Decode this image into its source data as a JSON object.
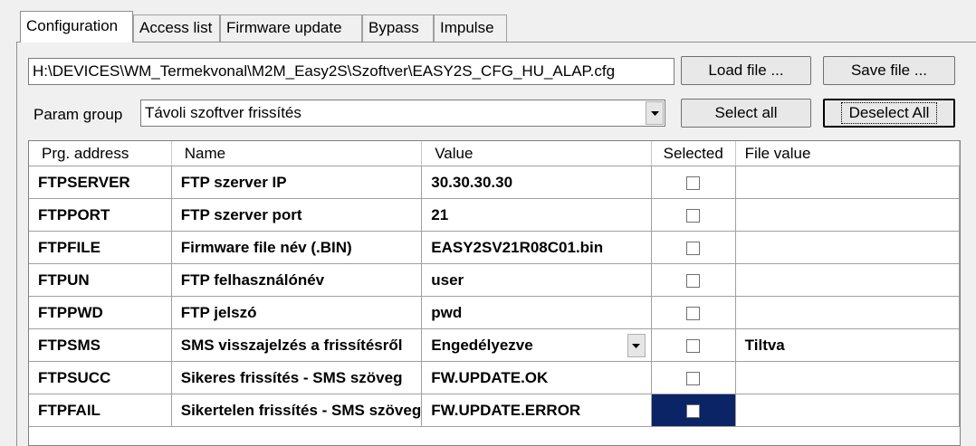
{
  "tabs": [
    {
      "label": "Configuration",
      "active": true
    },
    {
      "label": "Access list",
      "active": false
    },
    {
      "label": "Firmware update",
      "active": false
    },
    {
      "label": "Bypass",
      "active": false
    },
    {
      "label": "Impulse",
      "active": false
    }
  ],
  "file_path": "H:\\DEVICES\\WM_Termekvonal\\M2M_Easy2S\\Szoftver\\EASY2S_CFG_HU_ALAP.cfg",
  "buttons": {
    "load_file": "Load file ...",
    "save_file": "Save file ...",
    "select_all": "Select all",
    "deselect_all": "Deselect All"
  },
  "param_group": {
    "label": "Param group",
    "value": "Távoli szoftver frissítés"
  },
  "table": {
    "headers": [
      "Prg. address",
      "Name",
      "Value",
      "Selected",
      "File value"
    ],
    "rows": [
      {
        "address": "FTPSERVER",
        "name": "FTP szerver IP",
        "value": "30.30.30.30",
        "selected": false,
        "file_value": ""
      },
      {
        "address": "FTPPORT",
        "name": "FTP szerver port",
        "value": "21",
        "selected": false,
        "file_value": ""
      },
      {
        "address": "FTPFILE",
        "name": "Firmware file név (.BIN)",
        "value": "EASY2SV21R08C01.bin",
        "selected": false,
        "file_value": ""
      },
      {
        "address": "FTPUN",
        "name": "FTP felhasználónév",
        "value": "user",
        "selected": false,
        "file_value": ""
      },
      {
        "address": "FTPPWD",
        "name": "FTP jelszó",
        "value": "pwd",
        "selected": false,
        "file_value": ""
      },
      {
        "address": "FTPSMS",
        "name": "SMS visszajelzés a frissítésről",
        "value": "Engedélyezve",
        "selected": false,
        "file_value": "Tiltva"
      },
      {
        "address": "FTPSUCC",
        "name": "Sikeres frissítés - SMS szöveg",
        "value": "FW.UPDATE.OK",
        "selected": false,
        "file_value": ""
      },
      {
        "address": "FTPFAIL",
        "name": "Sikertelen frissítés - SMS szöveg",
        "value": "FW.UPDATE.ERROR",
        "selected": false,
        "file_value": ""
      }
    ]
  }
}
